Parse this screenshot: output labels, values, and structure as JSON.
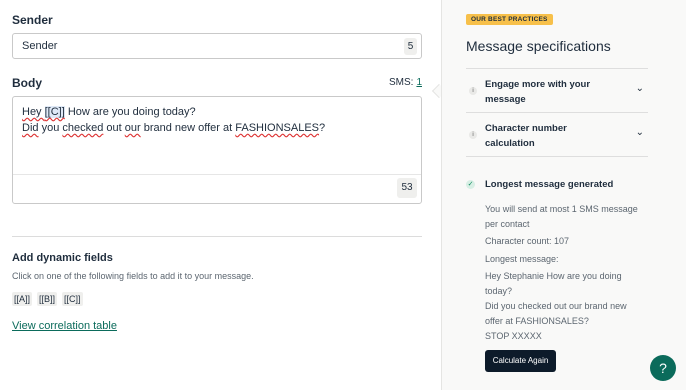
{
  "sender": {
    "label": "Sender",
    "value": "Sender",
    "count": "5"
  },
  "body": {
    "label": "Body",
    "sms_label": "SMS:",
    "sms_count": "1",
    "line1_pre": "Hey ",
    "line1_field": "[[C]]",
    "line1_post": " How are you doing today?",
    "line2_a": "Did",
    "line2_b": " you ",
    "line2_c": "checked",
    "line2_d": " out ",
    "line2_e": "our",
    "line2_f": " brand new offer at ",
    "line2_g": "FASHIONSALES",
    "line2_h": "?",
    "count": "53"
  },
  "dynamic": {
    "title": "Add dynamic fields",
    "help": "Click on one of the following fields to add it to your message.",
    "fields": [
      "[[A]]",
      "[[B]]",
      "[[C]]"
    ],
    "correlation_link": "View correlation table"
  },
  "specs": {
    "badge": "OUR BEST PRACTICES",
    "title": "Message specifications",
    "accordions": [
      {
        "label": "Engage more with your message",
        "icon": "info-icon"
      },
      {
        "label": "Character number calculation",
        "icon": "info-icon"
      }
    ],
    "longest_title": "Longest message generated",
    "info_send": "You will send at most 1 SMS message per contact",
    "info_count": "Character count: 107",
    "info_longest": "Longest message:",
    "longest_message": "Hey Stephanie How are you doing\ntoday?\nDid you checked out our brand new\noffer at FASHIONSALES?\nSTOP XXXXX",
    "calc_button": "Calculate Again",
    "help": "?"
  },
  "colors": {
    "accent": "#0b6b5b",
    "badge": "#f7c04a",
    "button_dark": "#0d1b2a",
    "panel_bg": "#f9f9f8"
  }
}
